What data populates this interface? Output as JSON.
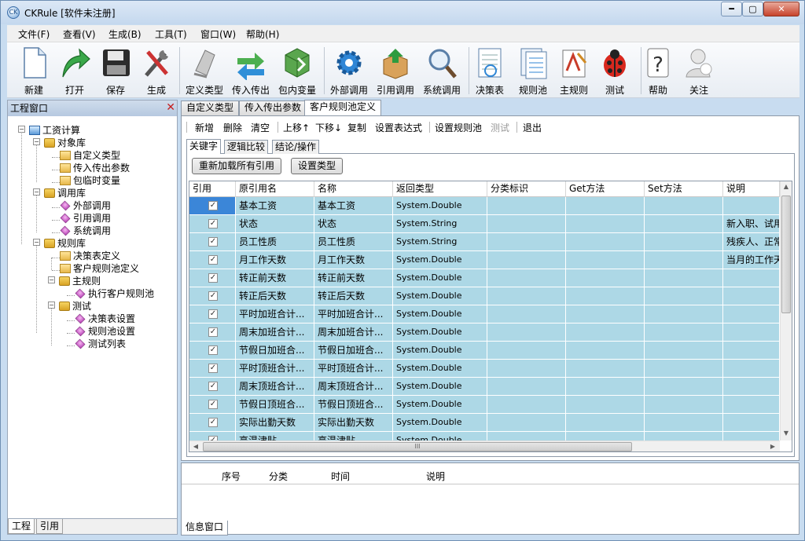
{
  "window": {
    "title": "CKRule [软件未注册]",
    "min": "━",
    "max": "▢",
    "close": "✕"
  },
  "menu": [
    "文件(F)",
    "查看(V)",
    "生成(B)",
    "工具(T)",
    "窗口(W)",
    "帮助(H)"
  ],
  "toolbar": [
    {
      "label": "新建",
      "icon": "new-file-icon"
    },
    {
      "label": "打开",
      "icon": "open-arrow-icon"
    },
    {
      "label": "保存",
      "icon": "floppy-disk-icon"
    },
    {
      "label": "生成",
      "icon": "tools-icon"
    },
    {
      "label": "定义类型",
      "icon": "define-type-icon"
    },
    {
      "label": "传入传出",
      "icon": "transfer-arrows-icon"
    },
    {
      "label": "包内变量",
      "icon": "package-icon"
    },
    {
      "label": "外部调用",
      "icon": "gear-icon"
    },
    {
      "label": "引用调用",
      "icon": "box-arrow-icon"
    },
    {
      "label": "系统调用",
      "icon": "magnifier-icon"
    },
    {
      "label": "决策表",
      "icon": "decision-table-icon"
    },
    {
      "label": "规则池",
      "icon": "rule-pool-icon"
    },
    {
      "label": "主规则",
      "icon": "main-rule-icon"
    },
    {
      "label": "测试",
      "icon": "ladybug-icon"
    },
    {
      "label": "帮助",
      "icon": "question-icon"
    },
    {
      "label": "关注",
      "icon": "person-icon"
    }
  ],
  "left_panel": {
    "title": "工程窗口",
    "tabs": [
      "工程",
      "引用"
    ],
    "tree": {
      "root": "工资计算",
      "object_lib": "对象库",
      "object_children": [
        "自定义类型",
        "传入传出参数",
        "包临时变量"
      ],
      "call_lib": "调用库",
      "call_children": [
        "外部调用",
        "引用调用",
        "系统调用"
      ],
      "rule_lib": "规则库",
      "rule_children": [
        "决策表定义",
        "客户规则池定义"
      ],
      "main_rule": "主规则",
      "main_rule_children": [
        "执行客户规则池"
      ],
      "test": "测试",
      "test_children": [
        "决策表设置",
        "规则池设置",
        "测试列表"
      ]
    }
  },
  "doc_tabs": [
    "自定义类型",
    "传入传出参数",
    "客户规则池定义"
  ],
  "sub_toolbar": [
    "新增",
    "删除",
    "清空",
    "上移↑",
    "下移↓",
    "复制",
    "设置表达式",
    "设置规则池",
    "测试",
    "退出"
  ],
  "inner_tabs": [
    "关键字",
    "逻辑比较",
    "结论/操作"
  ],
  "buttons": {
    "reload": "重新加载所有引用",
    "set_type": "设置类型"
  },
  "grid": {
    "headers": [
      "引用",
      "原引用名",
      "名称",
      "返回类型",
      "分类标识",
      "Get方法",
      "Set方法",
      "说明"
    ],
    "rows": [
      {
        "checked": true,
        "orig": "基本工资",
        "name": "基本工资",
        "type": "System.Double",
        "desc": ""
      },
      {
        "checked": true,
        "orig": "状态",
        "name": "状态",
        "type": "System.String",
        "desc": "新入职、试用"
      },
      {
        "checked": true,
        "orig": "员工性质",
        "name": "员工性质",
        "type": "System.String",
        "desc": "残疾人、正常"
      },
      {
        "checked": true,
        "orig": "月工作天数",
        "name": "月工作天数",
        "type": "System.Double",
        "desc": "当月的工作天"
      },
      {
        "checked": true,
        "orig": "转正前天数",
        "name": "转正前天数",
        "type": "System.Double",
        "desc": ""
      },
      {
        "checked": true,
        "orig": "转正后天数",
        "name": "转正后天数",
        "type": "System.Double",
        "desc": ""
      },
      {
        "checked": true,
        "orig": "平时加班合计...",
        "name": "平时加班合计...",
        "type": "System.Double",
        "desc": ""
      },
      {
        "checked": true,
        "orig": "周末加班合计...",
        "name": "周末加班合计...",
        "type": "System.Double",
        "desc": ""
      },
      {
        "checked": true,
        "orig": "节假日加班合...",
        "name": "节假日加班合...",
        "type": "System.Double",
        "desc": ""
      },
      {
        "checked": true,
        "orig": "平时顶班合计...",
        "name": "平时顶班合计...",
        "type": "System.Double",
        "desc": ""
      },
      {
        "checked": true,
        "orig": "周末顶班合计...",
        "name": "周末顶班合计...",
        "type": "System.Double",
        "desc": ""
      },
      {
        "checked": true,
        "orig": "节假日顶班合...",
        "name": "节假日顶班合...",
        "type": "System.Double",
        "desc": ""
      },
      {
        "checked": true,
        "orig": "实际出勤天数",
        "name": "实际出勤天数",
        "type": "System.Double",
        "desc": ""
      },
      {
        "checked": true,
        "orig": "高温津贴",
        "name": "高温津贴",
        "type": "System.Double",
        "desc": ""
      }
    ]
  },
  "info_panel": {
    "headers": [
      "序号",
      "分类",
      "时间",
      "说明"
    ],
    "tab": "信息窗口"
  },
  "colors": {
    "row_bg": "#add8e6",
    "selected": "#3b86d8"
  }
}
